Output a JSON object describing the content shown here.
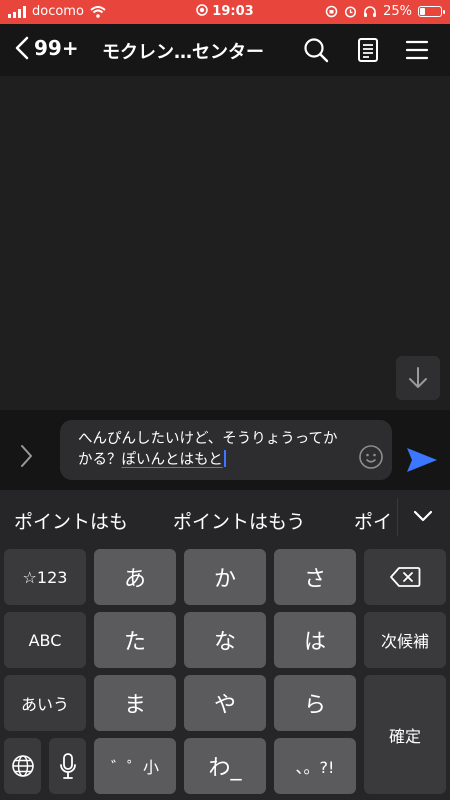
{
  "status_bar": {
    "carrier": "docomo",
    "time": "19:03",
    "battery_percent": "25%",
    "battery_level": 0.25
  },
  "header": {
    "back_count": "99+",
    "title": "モクレン…センター",
    "icons": [
      "search-icon",
      "notes-icon",
      "menu-icon"
    ]
  },
  "composer": {
    "text_committed": "へんぴんしたいけど、そうりょうってかかる？",
    "text_composing": "ぽいんとはもと"
  },
  "suggestions": {
    "items": [
      "ポイントはも",
      "ポイントはもう",
      "ポイ"
    ]
  },
  "keyboard": {
    "keys": {
      "symbols": "☆123",
      "a": "あ",
      "ka": "か",
      "sa": "さ",
      "abc": "ABC",
      "ta": "た",
      "na": "な",
      "ha": "は",
      "next_candidate": "次候補",
      "kana": "あいう",
      "ma": "ま",
      "ya": "や",
      "ra": "ら",
      "confirm": "確定",
      "dakuten": "゛゜小",
      "wa": "わ_",
      "punct": "、。?!"
    }
  },
  "colors": {
    "status_bar": "#e8453c",
    "accent_blue": "#3b78ff"
  }
}
